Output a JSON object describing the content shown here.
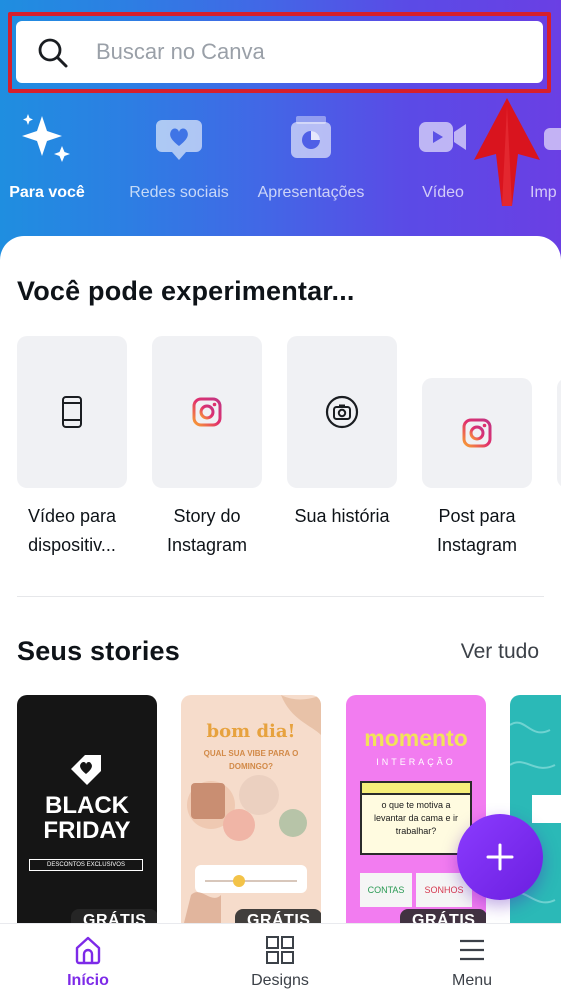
{
  "search": {
    "placeholder": "Buscar no Canva"
  },
  "categories": [
    {
      "label": "Para você",
      "icon": "sparkle-icon",
      "active": true
    },
    {
      "label": "Redes sociais",
      "icon": "heart-bubble-icon"
    },
    {
      "label": "Apresentações",
      "icon": "presentation-chart-icon"
    },
    {
      "label": "Vídeo",
      "icon": "video-camera-icon"
    },
    {
      "label": "Imp",
      "icon": "print-icon"
    }
  ],
  "suggestions": {
    "title": "Você pode experimentar...",
    "items": [
      {
        "line1": "Vídeo para",
        "line2": "dispositiv...",
        "icon": "mobile-phone-icon"
      },
      {
        "line1": "Story do",
        "line2": "Instagram",
        "icon": "instagram-icon"
      },
      {
        "line1": "Sua história",
        "line2": "",
        "icon": "camera-icon"
      },
      {
        "line1": "Post para",
        "line2": "Instagram",
        "icon": "instagram-icon"
      }
    ]
  },
  "stories": {
    "title": "Seus stories",
    "see_all": "Ver tudo",
    "items": [
      {
        "line1": "BLACK",
        "line2": "FRIDAY",
        "sub": "DESCONTOS EXCLUSIVOS",
        "badge": "GRÁTIS",
        "bg": "#151515"
      },
      {
        "heading": "bom dia!",
        "sub": "QUAL SUA VIBE PARA O DOMINGO?",
        "badge": "GRÁTIS",
        "bg": "#f6dccb"
      },
      {
        "heading": "momento",
        "sub": "INTERAÇÃO",
        "question": "o que te motiva a levantar da cama e ir trabalhar?",
        "opt1": "CONTAS",
        "opt2": "SONHOS",
        "badge": "GRÁTIS",
        "bg": "#f27cf0"
      },
      {
        "badge": "",
        "bg": "#2bb9b7"
      }
    ]
  },
  "nav": [
    {
      "label": "Início",
      "icon": "home-icon",
      "active": true
    },
    {
      "label": "Designs",
      "icon": "grid-icon"
    },
    {
      "label": "Menu",
      "icon": "menu-icon"
    }
  ],
  "colors": {
    "accent": "#7d2ae8",
    "highlight": "#d61f2c"
  }
}
